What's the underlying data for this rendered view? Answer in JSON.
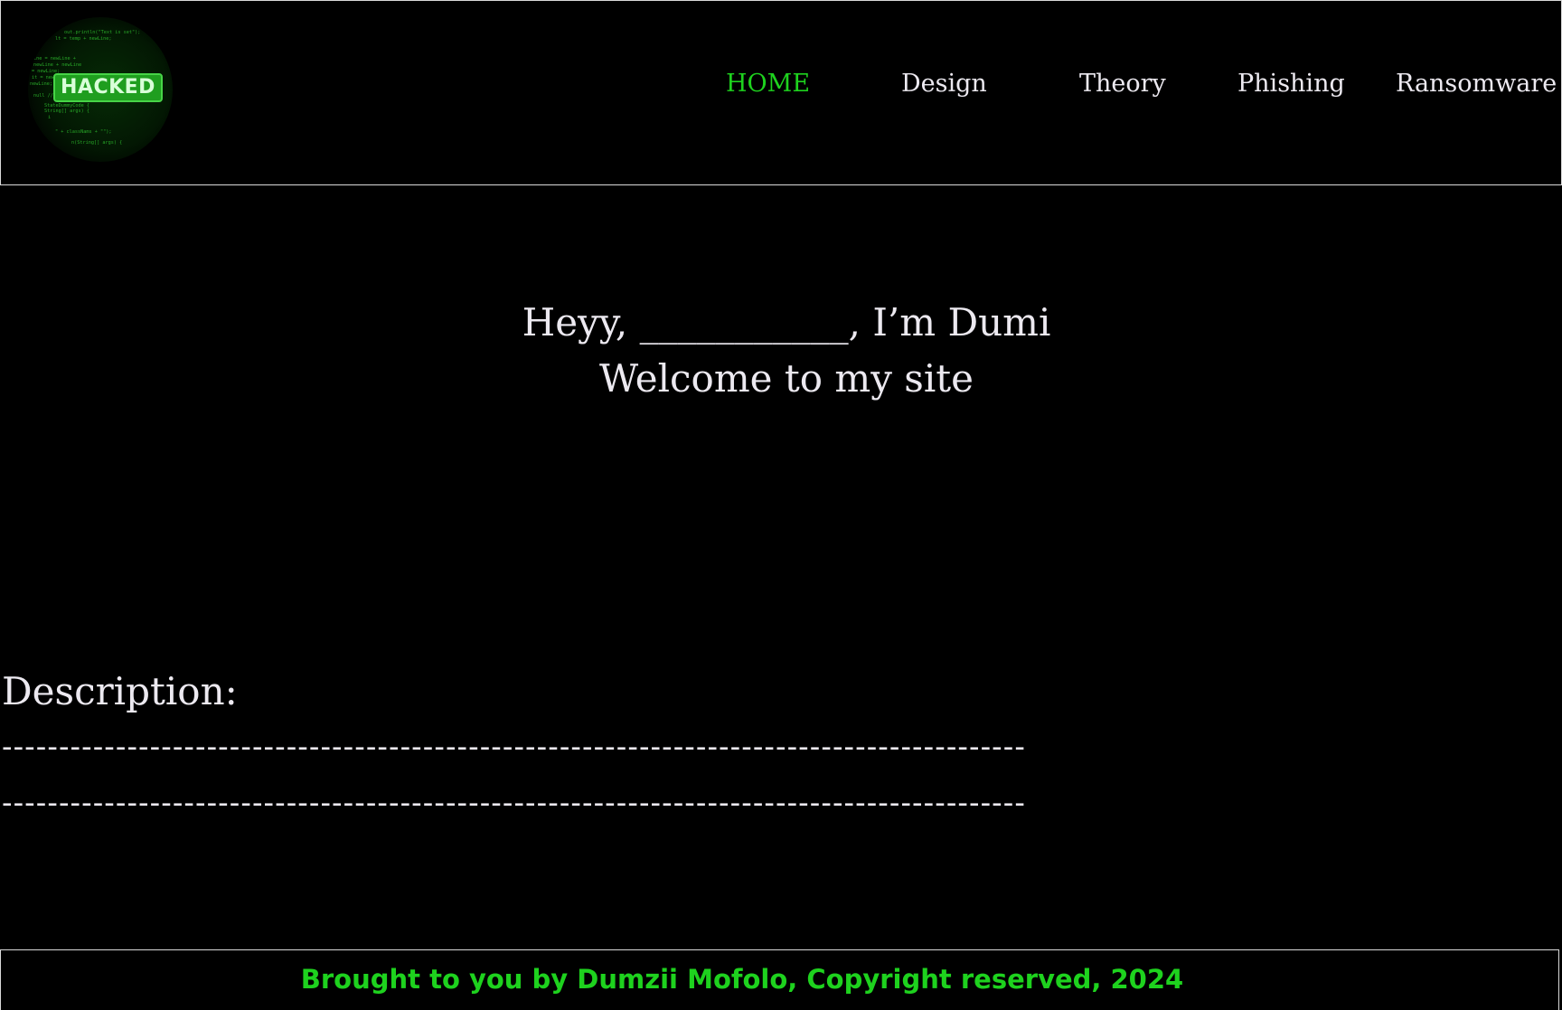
{
  "header": {
    "logo": {
      "badge_text": "HACKED",
      "code_lines": [
        "out.println(\"Text is set\");",
        "lt = temp + newLine;",
        "ine = newLine +",
        "newLine + newLine",
        "= newLine;",
        "it = newLine;",
        "newLine;",
        "null // To be continued",
        "StateDummyCode {",
        "String[] args) {",
        "i",
        "\" + classNams + \"\");",
        "n(String[] args) {"
      ]
    },
    "nav": [
      {
        "label": "HOME",
        "active": true
      },
      {
        "label": "Design",
        "active": false
      },
      {
        "label": "Theory",
        "active": false
      },
      {
        "label": "Phishing",
        "active": false
      },
      {
        "label": "Ransomware",
        "active": false
      }
    ]
  },
  "hero": {
    "line1": "Heyy, ___________, I’m Dumi",
    "line2": "Welcome to my site"
  },
  "description": {
    "title": "Description:",
    "line1": "------------------------------------------------------------------------------------------",
    "line2": "------------------------------------------------------------------------------------------"
  },
  "footer": {
    "text": "Brought to you by Dumzii Mofolo, Copyright reserved, 2024"
  },
  "colors": {
    "background": "#000000",
    "accent_green": "#1ed21e",
    "text": "#ece9f0",
    "border": "#d9d9d9"
  }
}
